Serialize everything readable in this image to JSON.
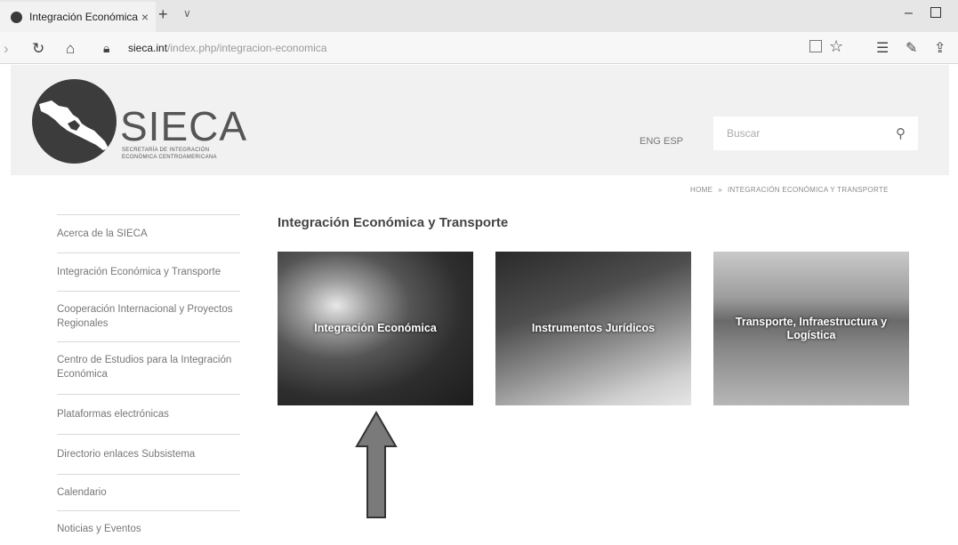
{
  "browser": {
    "tab_title": "Integración Económica",
    "tab_close": "×",
    "new_tab": "+",
    "tab_menu": "∨",
    "url_domain": "sieca.int",
    "url_path": "/index.php/integracion-economica"
  },
  "header": {
    "logo_name": "SIECA",
    "logo_sub_line1": "SECRETARÍA DE INTEGRACIÓN",
    "logo_sub_line2": "ECONÓMICA CENTROAMERICANA",
    "lang_eng": "ENG",
    "lang_esp": "ESP",
    "search_placeholder": "Buscar"
  },
  "breadcrumb": {
    "home": "HOME",
    "separator": "»",
    "current": "INTEGRACIÓN ECONÓMICA Y TRANSPORTE"
  },
  "sidebar": {
    "items": [
      {
        "label": "Acerca de la SIECA"
      },
      {
        "label": "Integración Económica y Transporte"
      },
      {
        "label": "Cooperación Internacional y Proyectos Regionales"
      },
      {
        "label": "Centro de Estudios para la Integración Económica"
      },
      {
        "label": "Plataformas electrónicas"
      },
      {
        "label": "Directorio enlaces Subsistema"
      },
      {
        "label": "Calendario"
      },
      {
        "label": "Noticias y Eventos"
      }
    ]
  },
  "main": {
    "title": "Integración Económica y Transporte",
    "cards": [
      {
        "label": "Integración Económica"
      },
      {
        "label": "Instrumentos Jurídicos"
      },
      {
        "label": "Transporte, Infraestructura y Logística"
      }
    ]
  },
  "icons": {
    "favicon": "globe-icon",
    "back": "back-arrow-icon",
    "refresh": "refresh-icon",
    "home": "home-icon",
    "lock": "lock-icon",
    "reading_view": "reading-view-icon",
    "favorite": "star-icon",
    "favorites_list": "favorites-list-icon",
    "notes": "pen-icon",
    "share": "share-icon",
    "search": "search-icon",
    "annotation_arrow": "up-arrow-icon"
  },
  "colors": {
    "header_bg": "#f1f1f1",
    "arrow_fill": "#7a7a7a",
    "logo": "#3c3c3c"
  }
}
